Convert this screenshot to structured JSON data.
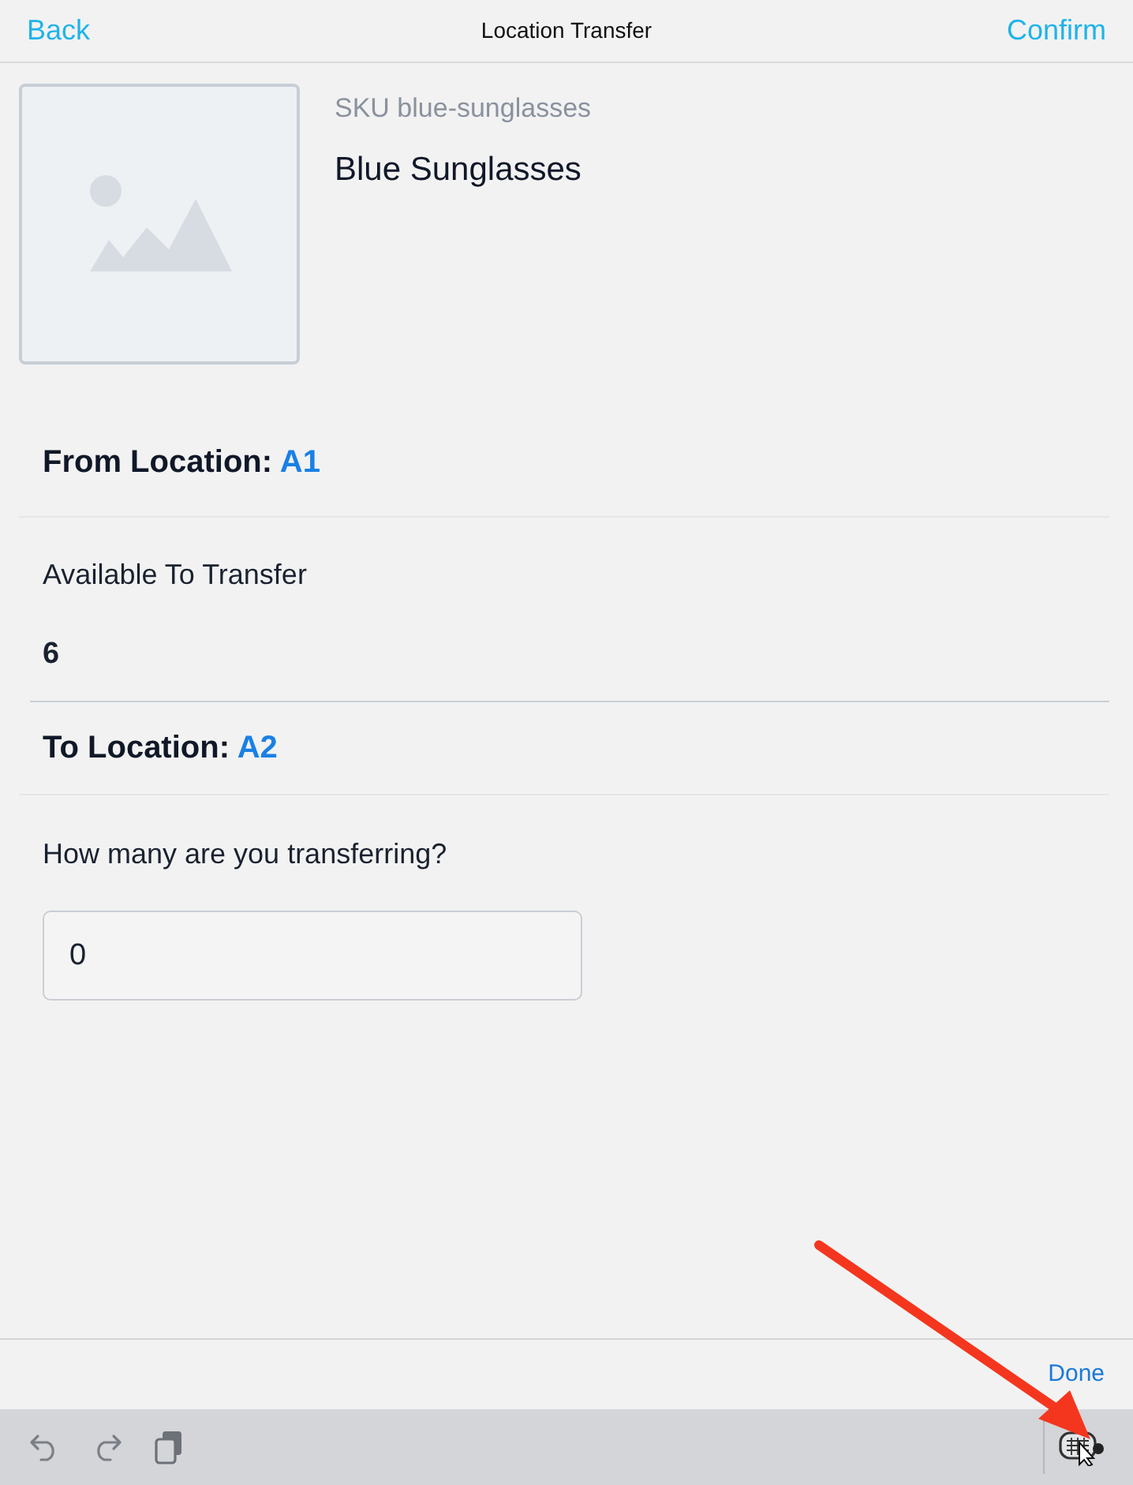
{
  "nav": {
    "back": "Back",
    "title": "Location Transfer",
    "confirm": "Confirm"
  },
  "product": {
    "sku": "SKU blue-sunglasses",
    "name": "Blue Sunglasses"
  },
  "from": {
    "label": "From Location:",
    "value": "A1"
  },
  "available": {
    "label": "Available To Transfer",
    "value": "6"
  },
  "to": {
    "label": "To Location:",
    "value": "A2"
  },
  "quantity": {
    "label": "How many are you transferring?",
    "value": "0"
  },
  "accessory_bar": {
    "done": "Done"
  },
  "annotation": {
    "arrow": true
  }
}
